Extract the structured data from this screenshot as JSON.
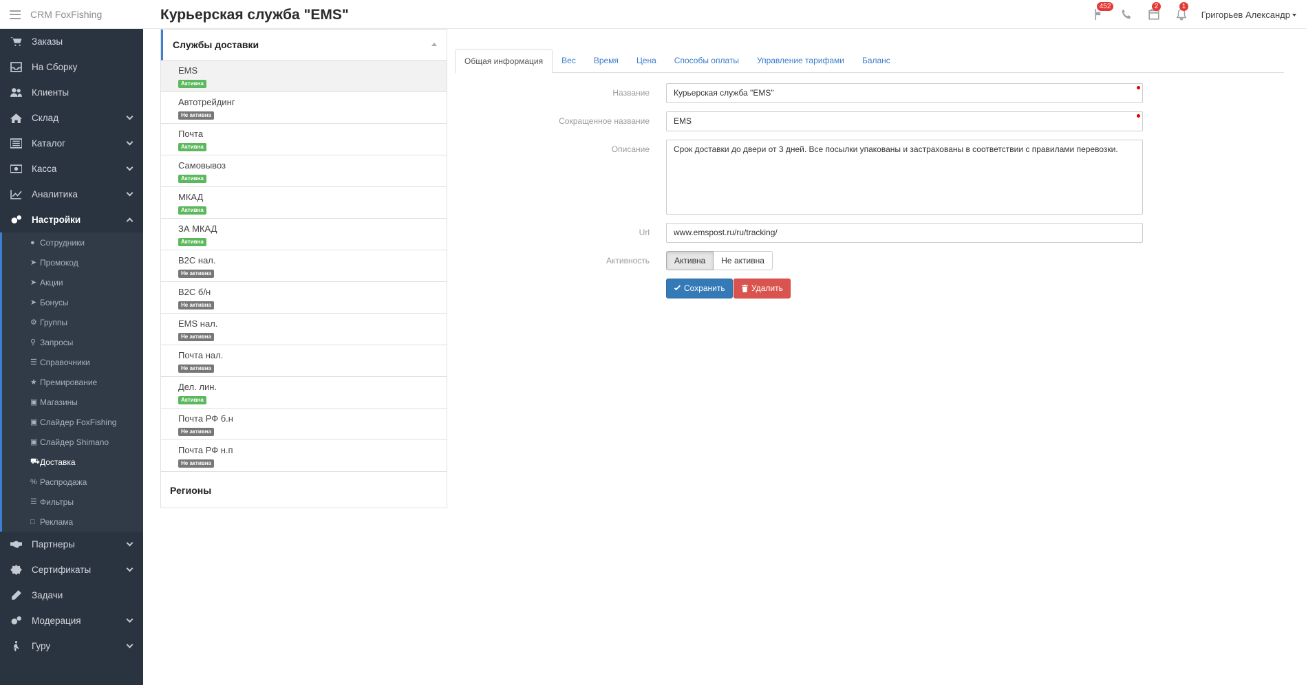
{
  "app": {
    "brand": "CRM FoxFishing",
    "page_title": "Курьерская служба \"EMS\""
  },
  "header": {
    "messages_count": "452",
    "calendar_count": "2",
    "notifications_count": "1",
    "user_name": "Григорьев Александр"
  },
  "sidebar": {
    "items": [
      {
        "label": "Заказы",
        "icon": "cart-icon"
      },
      {
        "label": "На Сборку",
        "icon": "inbox-icon"
      },
      {
        "label": "Клиенты",
        "icon": "users-icon"
      },
      {
        "label": "Склад",
        "icon": "home-icon"
      },
      {
        "label": "Каталог",
        "icon": "list-icon"
      },
      {
        "label": "Касса",
        "icon": "money-icon"
      },
      {
        "label": "Аналитика",
        "icon": "chart-icon"
      },
      {
        "label": "Настройки",
        "icon": "gears-icon"
      }
    ],
    "submenu": [
      {
        "label": "Сотрудники",
        "icon": "users-icon"
      },
      {
        "label": "Промокод",
        "icon": "tags-icon"
      },
      {
        "label": "Акции",
        "icon": "tags-icon"
      },
      {
        "label": "Бонусы",
        "icon": "tags-icon"
      },
      {
        "label": "Группы",
        "icon": "gear-icon"
      },
      {
        "label": "Запросы",
        "icon": "search-icon"
      },
      {
        "label": "Справочники",
        "icon": "list-icon"
      },
      {
        "label": "Премирование",
        "icon": "trophy-icon"
      },
      {
        "label": "Магазины",
        "icon": "cart-icon"
      },
      {
        "label": "Слайдер FoxFishing",
        "icon": "cart-icon"
      },
      {
        "label": "Слайдер Shimano",
        "icon": "cart-icon"
      },
      {
        "label": "Доставка",
        "icon": "truck-icon"
      },
      {
        "label": "Распродажа",
        "icon": "percent-icon"
      },
      {
        "label": "Фильтры",
        "icon": "list-icon"
      },
      {
        "label": "Реклама",
        "icon": "bookmark-icon"
      }
    ],
    "bottom_items": [
      {
        "label": "Партнеры",
        "icon": "handshake-icon"
      },
      {
        "label": "Сертификаты",
        "icon": "certificate-icon"
      },
      {
        "label": "Задачи",
        "icon": "pencil-icon"
      },
      {
        "label": "Модерация",
        "icon": "gears-icon"
      },
      {
        "label": "Гуру",
        "icon": "walk-icon"
      }
    ]
  },
  "services": {
    "title": "Службы доставки",
    "items": [
      {
        "name": "EMS",
        "status": "Активна"
      },
      {
        "name": "Автотрейдинг",
        "status": "Не активна"
      },
      {
        "name": "Почта",
        "status": "Активна"
      },
      {
        "name": "Самовывоз",
        "status": "Активна"
      },
      {
        "name": "МКАД",
        "status": "Активна"
      },
      {
        "name": "ЗА МКАД",
        "status": "Активна"
      },
      {
        "name": "B2C нал.",
        "status": "Не активна"
      },
      {
        "name": "B2C б/н",
        "status": "Не активна"
      },
      {
        "name": "EMS нал.",
        "status": "Не активна"
      },
      {
        "name": "Почта нал.",
        "status": "Не активна"
      },
      {
        "name": "Дел. лин.",
        "status": "Активна"
      },
      {
        "name": "Почта РФ б.н",
        "status": "Не активна"
      },
      {
        "name": "Почта РФ н.п",
        "status": "Не активна"
      }
    ],
    "regions": "Регионы"
  },
  "tabs": [
    "Общая информация",
    "Вес",
    "Время",
    "Цена",
    "Способы оплаты",
    "Управление тарифами",
    "Баланс"
  ],
  "form": {
    "name_label": "Название",
    "name_value": "Курьерская служба \"EMS\"",
    "short_label": "Сокращенное название",
    "short_value": "EMS",
    "desc_label": "Описание",
    "desc_value": "Срок доставки до двери от 3 дней. Все посылки упакованы и застрахованы в соответствии с правилами перевозки.",
    "url_label": "Url",
    "url_value": "www.emspost.ru/ru/tracking/",
    "active_label": "Активность",
    "active_on": "Активна",
    "active_off": "Не активна",
    "save": "Сохранить",
    "delete": "Удалить"
  }
}
